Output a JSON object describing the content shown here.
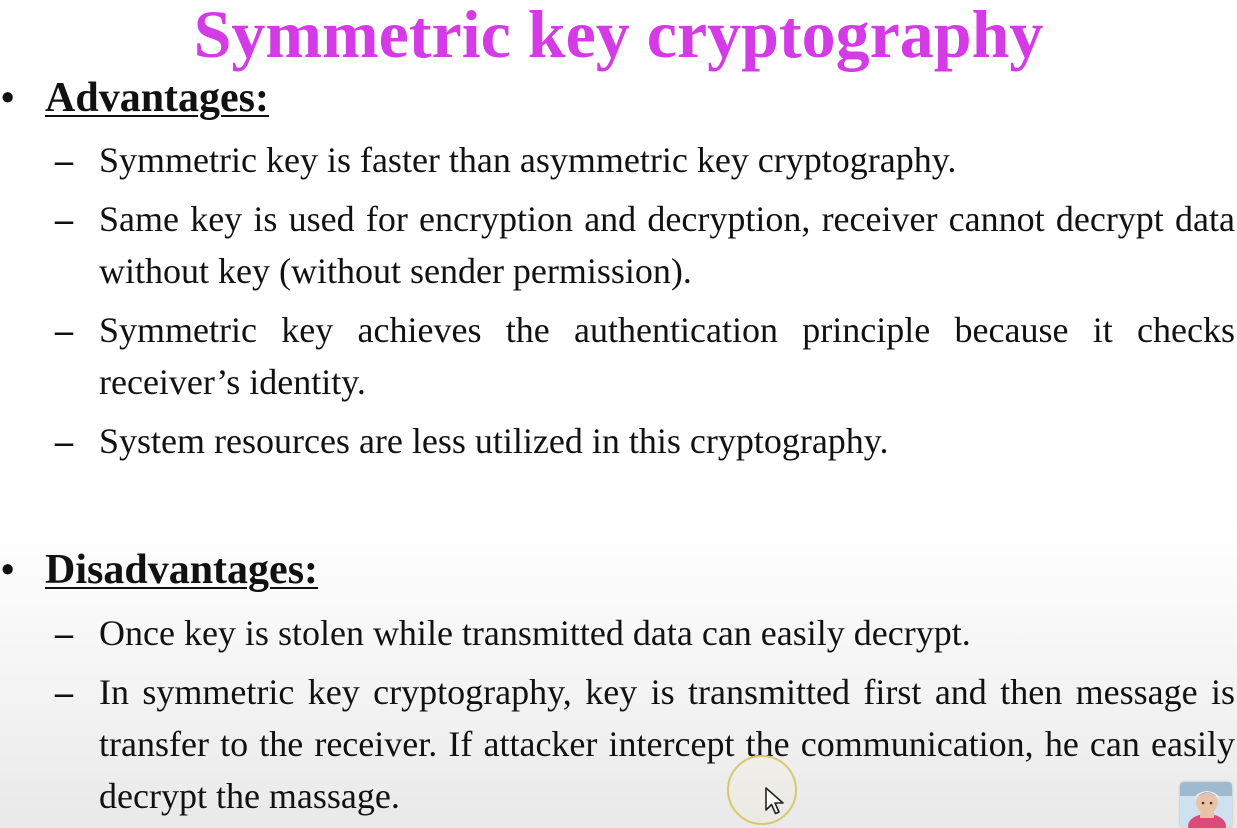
{
  "title": "Symmetric key cryptography",
  "advantages": {
    "heading": "Advantages:",
    "bullet": "•",
    "items": [
      "Symmetric key is faster than asymmetric key cryptography.",
      "Same key is used for encryption and decryption, receiver cannot decrypt data without key (without sender permission).",
      "Symmetric key achieves the authentication principle because it checks receiver’s identity.",
      "System resources are less utilized in this cryptography."
    ]
  },
  "disadvantages": {
    "heading": "Disadvantages:",
    "bullet": "•",
    "items": [
      "Once key is stolen while transmitted data can easily decrypt.",
      "In symmetric key cryptography, key is transmitted first and then message is transfer to the receiver. If attacker intercept the communication, he can easily decrypt the massage."
    ]
  },
  "dash": "–",
  "colors": {
    "title": "#d43ae6",
    "text": "#111111",
    "cursor_ring": "#d9c86b"
  },
  "icons": {
    "cursor": "mouse-pointer-icon",
    "presenter": "presenter-avatar"
  }
}
